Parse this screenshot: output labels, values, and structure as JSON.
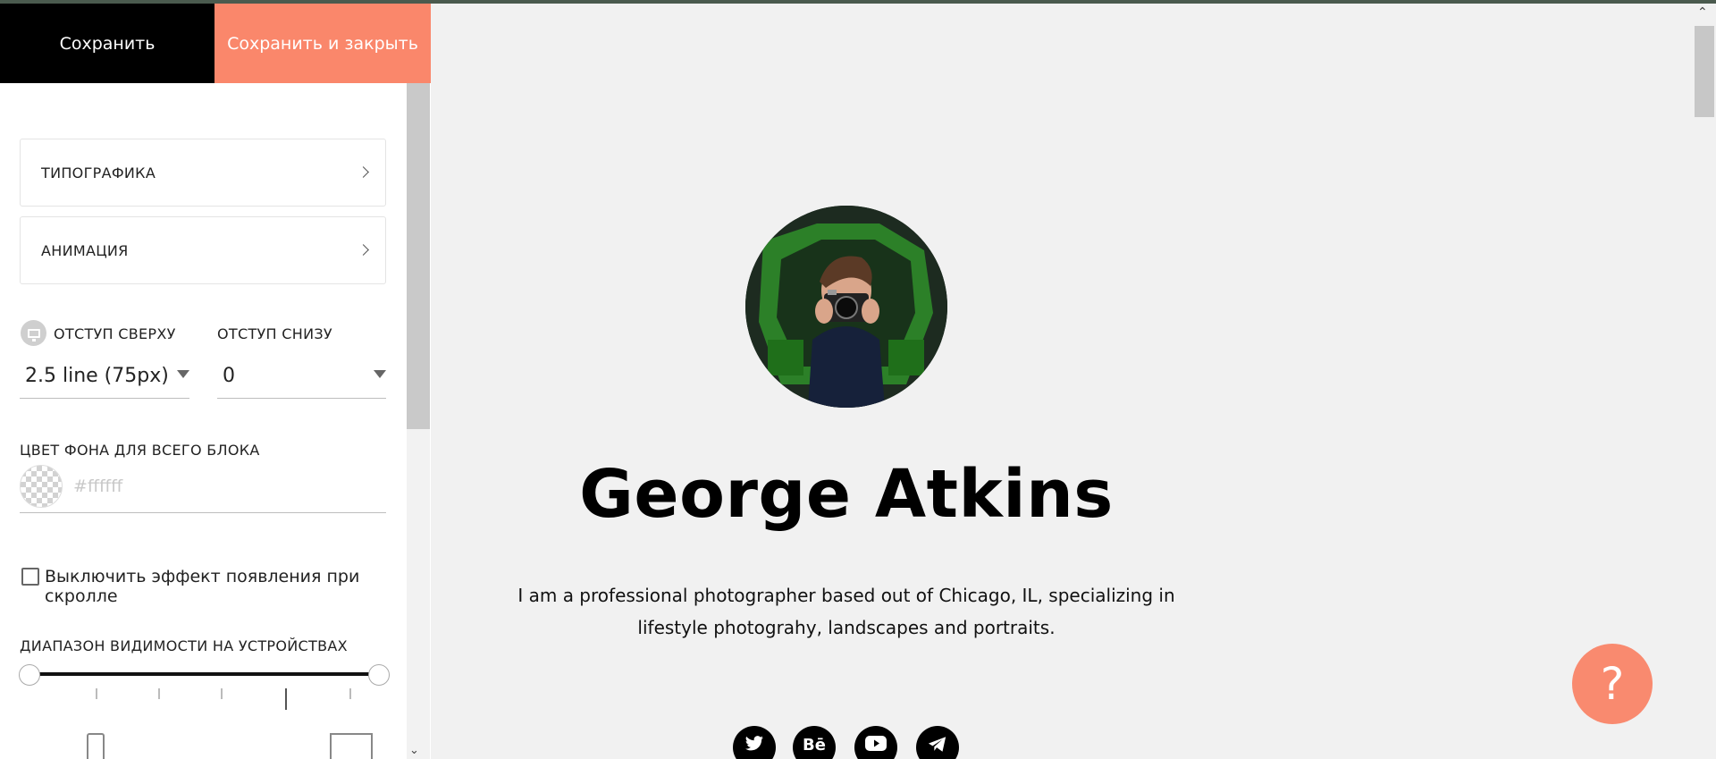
{
  "toolbar": {
    "save_label": "Сохранить",
    "save_close_label": "Сохранить и закрыть"
  },
  "settings": {
    "typography_label": "ТИПОГРАФИКА",
    "animation_label": "АНИМАЦИЯ",
    "padding_top_label": "ОТСТУП СВЕРХУ",
    "padding_top_value": "2.5 line (75px)",
    "padding_bottom_label": "ОТСТУП СНИЗУ",
    "padding_bottom_value": "0",
    "bg_color_label": "ЦВЕТ ФОНА ДЛЯ ВСЕГО БЛОКА",
    "bg_color_placeholder": "#ffffff",
    "scroll_effect_label": "Выключить эффект появления при скролле",
    "scroll_effect_checked": false,
    "visibility_range_label": "ДИАПАЗОН ВИДИМОСТИ НА УСТРОЙСТВАХ"
  },
  "preview": {
    "name": "George Atkins",
    "bio": "I am a professional photographer based out of Chicago, IL, specializing in lifestyle photograhy, landscapes and portraits.",
    "social": [
      {
        "icon": "twitter-icon"
      },
      {
        "icon": "behance-icon",
        "glyph": "Bē"
      },
      {
        "icon": "youtube-icon"
      },
      {
        "icon": "telegram-icon"
      }
    ]
  },
  "help": {
    "glyph": "?"
  },
  "colors": {
    "accent": "#fa876b",
    "save_bg": "#000000"
  }
}
